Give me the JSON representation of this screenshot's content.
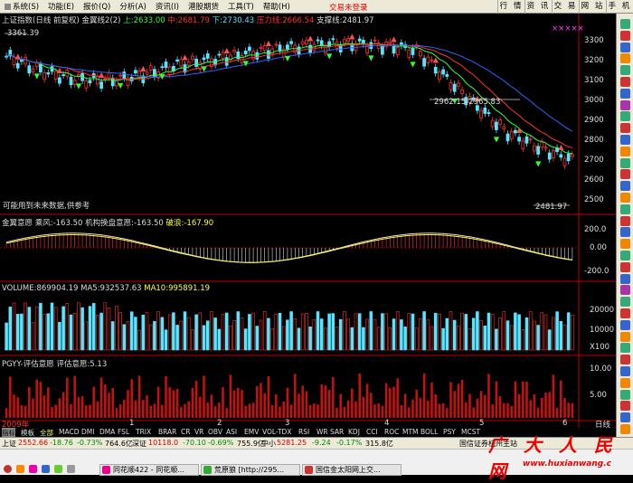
{
  "menubar": {
    "items": [
      "系统(S)",
      "功能(E)",
      "报价(Q)",
      "分析(A)",
      "资讯(I)",
      "港股期货",
      "工具(T)",
      "帮助(H)"
    ],
    "login_status": "交易未登录",
    "tabs": [
      "行 情",
      "资 讯",
      "交 易",
      "网 站",
      "手 机"
    ]
  },
  "header": {
    "index": "上证指数(日线 前复权) 金翼线2(2)",
    "up": "上:2633.00",
    "mid": "中:2681.79",
    "down": "下:2730.43",
    "pressure": "压力线:2666.54",
    "support": "支撑线:2481.97",
    "stars": "×××××"
  },
  "main_chart": {
    "high_label": "3361.39",
    "low_label": "2481.97",
    "annotation": "2962.15-2965.83",
    "note": "可能用到未来数据,供参考",
    "y_ticks": [
      "3300",
      "3200",
      "3100",
      "3000",
      "2900",
      "2800",
      "2700",
      "2600",
      "2500"
    ]
  },
  "osc_panel": {
    "title": "金翼意愿",
    "v1": "乘风:-163.50",
    "v2": "机构换盘意愿:-163.50",
    "v3": "破浪:-167.90",
    "y_ticks": [
      "200.0",
      "0.00",
      "-200.0"
    ]
  },
  "volume_panel": {
    "v0": "VOLUME:869904.19",
    "v1": "MA5:932537.63",
    "v2": "MA10:995891.19",
    "y_ticks": [
      "20000",
      "10000",
      "X100"
    ]
  },
  "pgyy_panel": {
    "title": "PGYY-评估意愿",
    "v1": "评估意愿:5.13",
    "y_ticks": [
      "10.00",
      "5.00"
    ]
  },
  "x_axis": {
    "year": "2009年",
    "ticks": [
      "1",
      "2",
      "3",
      "4",
      "5",
      "6"
    ],
    "right_label": "日线"
  },
  "bottom_tabs": [
    "指标",
    "模板",
    "全部",
    "MACD",
    "DMI",
    "DMA",
    "FSL",
    "TRIX",
    "BRAR",
    "CR",
    "VR",
    "OBV",
    "ASI",
    "EMV",
    "VOL-TDX",
    "RSI",
    "WR",
    "SAR",
    "KDJ",
    "CCI",
    "ROC",
    "MTM",
    "BOLL",
    "PSY",
    "MCST"
  ],
  "statusbar": {
    "sh_label": "上证",
    "sh_price": "2552.66",
    "sh_change": "-18.76",
    "sh_pct": "-0.73%",
    "sh_vol": "764.6亿",
    "sz_label": "深证",
    "sz_price": "10118.0",
    "sz_change": "-70.10",
    "sz_pct": "-0.69%",
    "sz_vol": "755.9亿",
    "zx_label": "中小",
    "zx_price": "5281.25",
    "zx_change": "-9.24",
    "zx_pct": "-0.17%",
    "zx_vol": "315.8亿",
    "broker": "国信证券杭州主站"
  },
  "taskbar": {
    "tasks": [
      "同花顺422 - 同花顺...",
      "荒原狼 [http://295...",
      "国信金太阳网上交..."
    ]
  },
  "watermark": {
    "text": "广 大 人 民 网",
    "url": "www.huxianwang.c"
  }
}
